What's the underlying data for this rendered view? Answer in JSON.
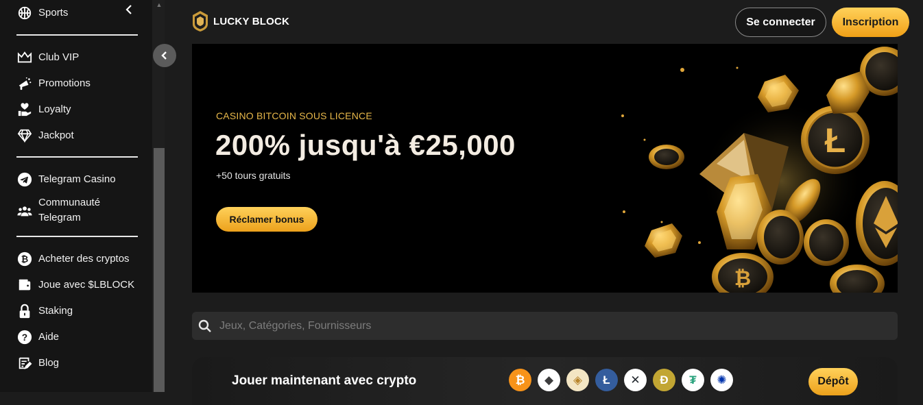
{
  "sidebar": {
    "top_item": {
      "label": "Sports",
      "icon": "basketball-icon"
    },
    "group1": [
      {
        "label": "Club VIP",
        "icon": "crown-icon"
      },
      {
        "label": "Promotions",
        "icon": "megaphone-icon"
      },
      {
        "label": "Loyalty",
        "icon": "heart-hand-icon"
      },
      {
        "label": "Jackpot",
        "icon": "diamond-icon"
      }
    ],
    "group2": [
      {
        "label": "Telegram Casino",
        "icon": "telegram-icon"
      },
      {
        "label": "Communauté\nTelegram",
        "icon": "community-icon"
      }
    ],
    "group3": [
      {
        "label": "Acheter des cryptos",
        "icon": "bitcoin-icon"
      },
      {
        "label": "Joue avec $LBLOCK",
        "icon": "wallet-icon"
      },
      {
        "label": "Staking",
        "icon": "lock-icon"
      },
      {
        "label": "Aide",
        "icon": "help-icon"
      },
      {
        "label": "Blog",
        "icon": "blog-icon"
      }
    ]
  },
  "header": {
    "logo_text": "LUCKY BLOCK",
    "login_label": "Se connecter",
    "signup_label": "Inscription"
  },
  "banner": {
    "eyebrow": "CASINO BITCOIN SOUS LICENCE",
    "title": "200% jusqu'à €25,000",
    "subtitle": "+50 tours gratuits",
    "cta_label": "Réclamer bonus"
  },
  "search": {
    "placeholder": "Jeux, Catégories, Fournisseurs"
  },
  "crypto_bar": {
    "title": "Jouer maintenant avec crypto",
    "deposit_label": "Dépôt",
    "coins": [
      {
        "name": "bitcoin",
        "symbol": "₿",
        "bg": "#f7931a",
        "fg": "#ffffff"
      },
      {
        "name": "ethereum",
        "symbol": "◆",
        "bg": "#ffffff",
        "fg": "#3c3c3d"
      },
      {
        "name": "lucky-block",
        "symbol": "◈",
        "bg": "#f3e6c4",
        "fg": "#b8862d"
      },
      {
        "name": "litecoin",
        "symbol": "Ł",
        "bg": "#345d9d",
        "fg": "#ffffff"
      },
      {
        "name": "xrp",
        "symbol": "✕",
        "bg": "#ffffff",
        "fg": "#23292f"
      },
      {
        "name": "dogecoin",
        "symbol": "Ð",
        "bg": "#c2a633",
        "fg": "#ffffff"
      },
      {
        "name": "tether",
        "symbol": "₮",
        "bg": "#ffffff",
        "fg": "#26a17b"
      },
      {
        "name": "cardano",
        "symbol": "✺",
        "bg": "#ffffff",
        "fg": "#0033ad"
      }
    ]
  },
  "colors": {
    "accent_gold": "#f5b52a",
    "sidebar_bg": "#151515",
    "page_bg": "#1c1c1c"
  }
}
